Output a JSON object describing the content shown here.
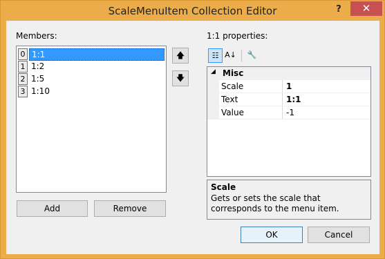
{
  "window": {
    "title": "ScaleMenuItem Collection Editor",
    "help_label": "?",
    "close_label": "✕"
  },
  "members": {
    "label": "Members:",
    "items": [
      {
        "index": "0",
        "text": "1:1",
        "selected": true
      },
      {
        "index": "1",
        "text": "1:2",
        "selected": false
      },
      {
        "index": "2",
        "text": "1:5",
        "selected": false
      },
      {
        "index": "3",
        "text": "1:10",
        "selected": false
      }
    ]
  },
  "move_buttons": {
    "up_icon": "arrow-up-icon",
    "up_glyph": "🡅",
    "down_icon": "arrow-down-icon",
    "down_glyph": "🡇"
  },
  "buttons": {
    "add": "Add",
    "remove": "Remove",
    "ok": "OK",
    "cancel": "Cancel"
  },
  "properties": {
    "label": "1:1 properties:",
    "toolbar": {
      "categorized_glyph": "☷",
      "alphabetical_glyph": "A↓",
      "property_pages_glyph": "🔧"
    },
    "category": {
      "name": "Misc",
      "toggle_glyph": "◢"
    },
    "rows": [
      {
        "name": "Scale",
        "value": "1",
        "bold": true
      },
      {
        "name": "Text",
        "value": "1:1",
        "bold": true
      },
      {
        "name": "Value",
        "value": "-1",
        "bold": false
      }
    ]
  },
  "description": {
    "title": "Scale",
    "text": "Gets or sets the scale that corresponds to the menu item."
  },
  "colors": {
    "title_bar": "#ecac4a",
    "close_button": "#c75050",
    "selection": "#3399ff"
  }
}
